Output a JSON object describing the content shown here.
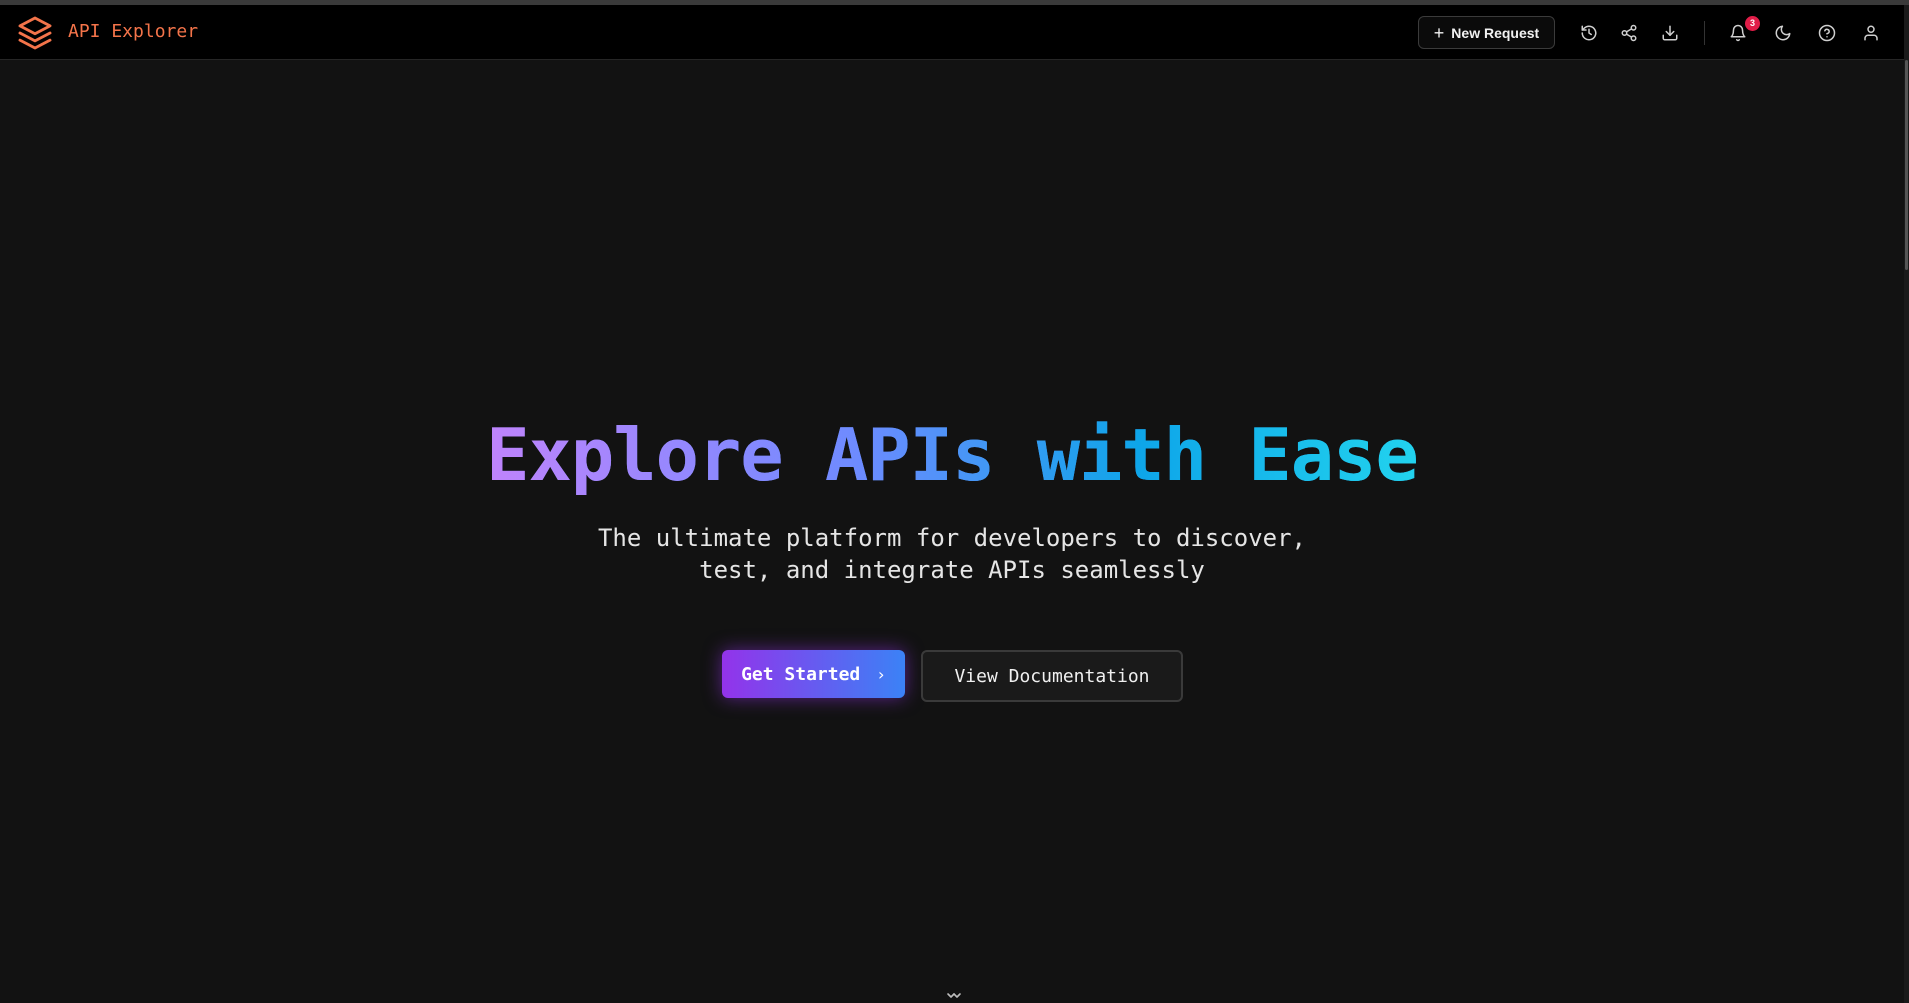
{
  "app": {
    "title": "API Explorer",
    "logo_icon": "layers-icon",
    "accent_color": "#f4744a"
  },
  "header": {
    "new_request_label": "New Request",
    "new_request_icon": "plus-icon",
    "icons": [
      "history-icon",
      "share-icon",
      "download-icon",
      "bell-icon",
      "moon-icon",
      "help-icon",
      "user-icon"
    ],
    "notification_count": "3",
    "badge_color": "#e11d48"
  },
  "hero": {
    "title": "Explore APIs with Ease",
    "subtitle_line1": "The ultimate platform for developers to discover,",
    "subtitle_line2": "test, and integrate APIs seamlessly",
    "gradient_colors": [
      "#c084fc",
      "#6d8bff",
      "#0ea5e9",
      "#22d3ee"
    ]
  },
  "actions": {
    "primary_label": "Get Started",
    "primary_icon": "chevron-right-icon",
    "primary_colors": [
      "#9333ea",
      "#3b82f6"
    ],
    "secondary_label": "View Documentation"
  },
  "scroll_hint_icon": "chevrons-down-icon"
}
